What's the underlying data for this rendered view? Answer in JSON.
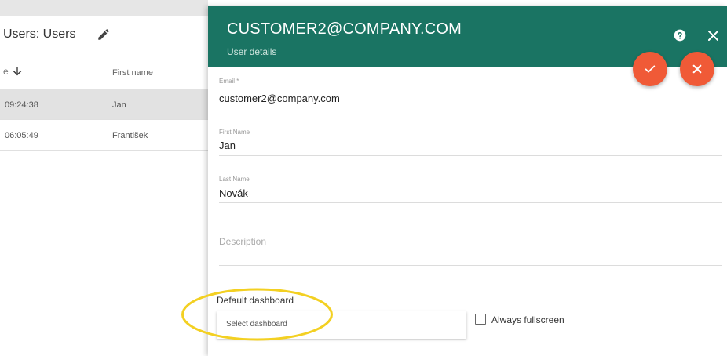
{
  "background_page": {
    "title": "Users: Users",
    "sort_lead": "e",
    "column_first_name": "First name",
    "rows": [
      {
        "time": "09:24:38",
        "first_name": "Jan"
      },
      {
        "time": "06:05:49",
        "first_name": "František"
      }
    ]
  },
  "dialog": {
    "title": "CUSTOMER2@COMPANY.COM",
    "subtitle": "User details",
    "colors": {
      "header": "#1a7463",
      "fab": "#f05a37",
      "highlight": "#f3d022"
    },
    "fields": {
      "email": {
        "label": "Email *",
        "value": "customer2@company.com"
      },
      "first_name": {
        "label": "First Name",
        "value": "Jan"
      },
      "last_name": {
        "label": "Last Name",
        "value": "Novák"
      },
      "description": {
        "placeholder": "Description"
      }
    },
    "default_dashboard": {
      "label": "Default dashboard",
      "placeholder": "Select dashboard"
    },
    "always_fullscreen": {
      "label": "Always fullscreen",
      "checked": false
    }
  },
  "icons": [
    "edit-icon",
    "sort-down-icon",
    "help-icon",
    "close-icon",
    "check-icon",
    "cancel-icon"
  ]
}
